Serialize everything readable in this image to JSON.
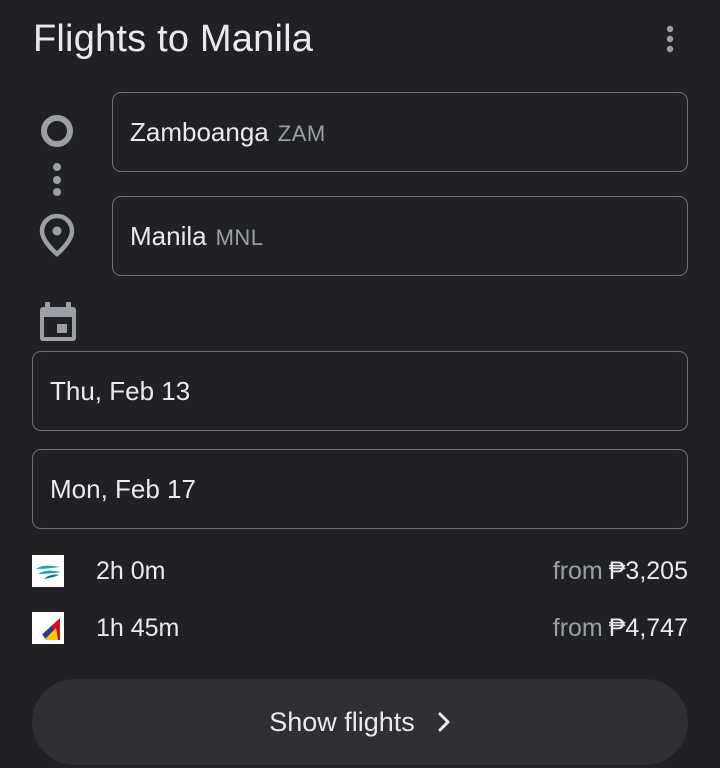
{
  "header": {
    "title": "Flights to Manila",
    "more_icon": "more-vertical-icon"
  },
  "route": {
    "origin": {
      "city": "Zamboanga",
      "code": "ZAM",
      "icon": "origin-circle-icon"
    },
    "destination": {
      "city": "Manila",
      "code": "MNL",
      "icon": "location-pin-icon"
    },
    "connector_icon": "route-dots-icon"
  },
  "dates": {
    "icon": "calendar-icon",
    "departure": "Thu, Feb 13",
    "return": "Mon, Feb 17"
  },
  "flights": [
    {
      "airline_icon": "cebu-pacific-logo-icon",
      "duration": "2h 0m",
      "from_label": "from",
      "price": "₱3,205"
    },
    {
      "airline_icon": "philippine-airlines-logo-icon",
      "duration": "1h 45m",
      "from_label": "from",
      "price": "₱4,747"
    }
  ],
  "actions": {
    "show_flights_label": "Show flights",
    "chevron_icon": "chevron-right-icon"
  },
  "colors": {
    "background": "#202124",
    "text": "#e8eaed",
    "muted_text": "#9aa0a6",
    "field_border": "#6f7174",
    "button_bg": "#2f3033",
    "icon": "#9aa0a6"
  }
}
